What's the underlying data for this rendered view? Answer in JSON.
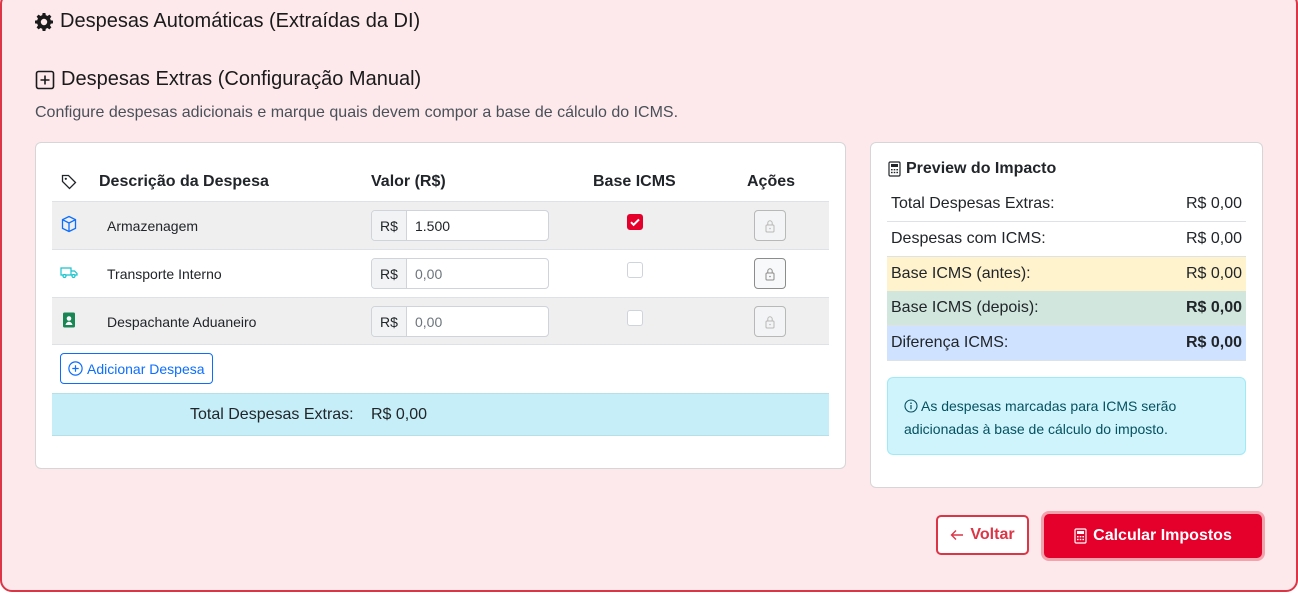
{
  "sections": {
    "auto_title": "Despesas Automáticas (Extraídas da DI)",
    "extra_title": "Despesas Extras (Configuração Manual)",
    "extra_subtitle": "Configure despesas adicionais e marque quais devem compor a base de cálculo do ICMS."
  },
  "table": {
    "headers": {
      "description": "Descrição da Despesa",
      "value": "Valor (R$)",
      "icms": "Base ICMS",
      "actions": "Ações"
    },
    "currency_prefix": "R$",
    "rows": [
      {
        "icon": "box-icon",
        "description": "Armazenagem",
        "value": "1.500",
        "icms_checked": true
      },
      {
        "icon": "truck-icon",
        "description": "Transporte Interno",
        "value": "",
        "placeholder": "0,00",
        "icms_checked": false
      },
      {
        "icon": "person-badge-icon",
        "description": "Despachante Aduaneiro",
        "value": "",
        "placeholder": "0,00",
        "icms_checked": false
      }
    ],
    "add_button": "Adicionar Despesa",
    "total_label": "Total Despesas Extras:",
    "total_value": "R$ 0,00"
  },
  "preview": {
    "title": "Preview do Impacto",
    "rows": [
      {
        "label": "Total Despesas Extras:",
        "value": "R$ 0,00"
      },
      {
        "label": "Despesas com ICMS:",
        "value": "R$ 0,00"
      },
      {
        "label": "Base ICMS (antes):",
        "value": "R$ 0,00"
      },
      {
        "label": "Base ICMS (depois):",
        "value": "R$ 0,00"
      },
      {
        "label": "Diferença ICMS:",
        "value": "R$ 0,00"
      }
    ],
    "alert": "As despesas marcadas para ICMS serão adicionadas à base de cálculo do imposto."
  },
  "buttons": {
    "back": "Voltar",
    "calculate": "Calcular Impostos"
  },
  "colors": {
    "accent": "#e4002b",
    "primary": "#0d6efd",
    "info_bg": "#cff4fc",
    "warning_bg": "#fff3cd",
    "success_bg": "#d1e7dd"
  }
}
